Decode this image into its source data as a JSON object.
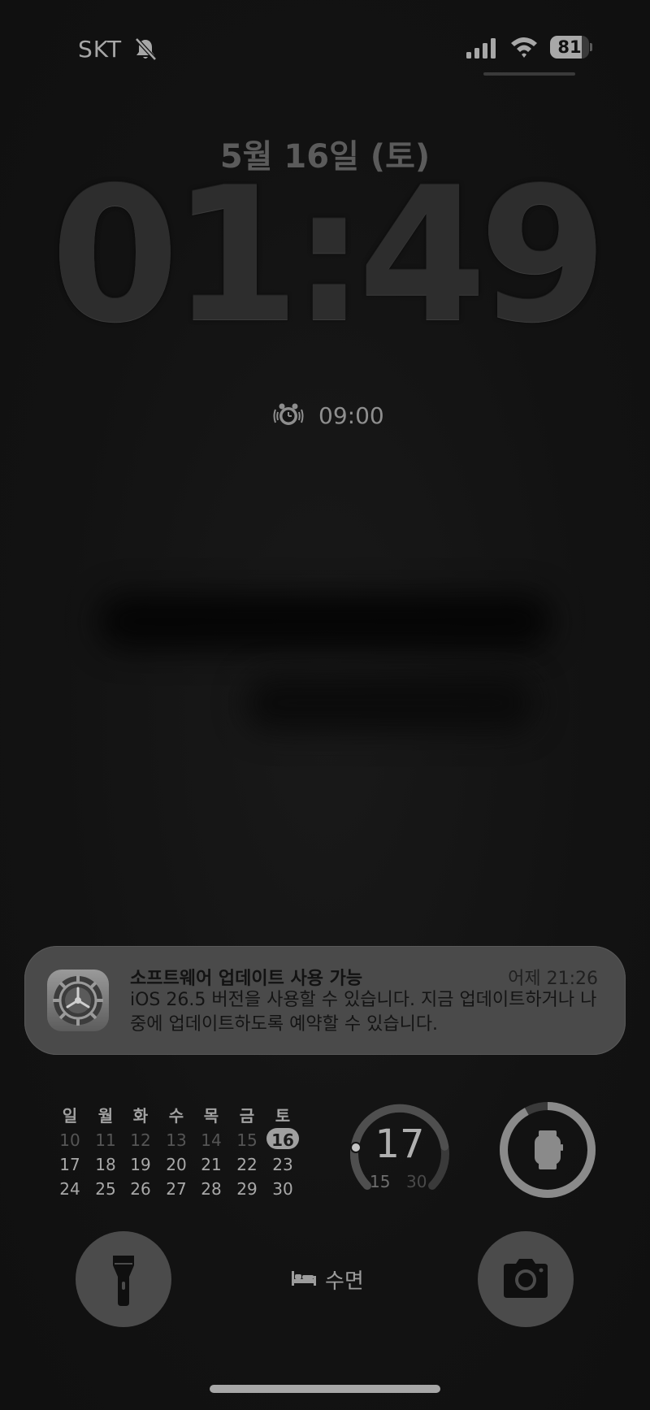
{
  "status_bar": {
    "carrier": "SKT",
    "silent_icon": "bell-slash-icon",
    "signal_icon": "cellular-signal-icon",
    "wifi_icon": "wifi-icon",
    "battery_level": "81",
    "battery_fraction": 0.81
  },
  "lock_screen": {
    "date": "5월 16일 (토)",
    "time": "01:49"
  },
  "alarm": {
    "icon": "alarm-clock-icon",
    "time": "09:00"
  },
  "notification": {
    "app_icon": "settings-gear-icon",
    "title": "소프트웨어 업데이트 사용 가능",
    "time": "어제 21:26",
    "body": "iOS 26.5 버전을 사용할 수 있습니다. 지금 업데이트하거나 나중에 업데이트하도록 예약할 수 있습니다."
  },
  "calendar_widget": {
    "weekdays": [
      "일",
      "월",
      "화",
      "수",
      "목",
      "금",
      "토"
    ],
    "weeks": [
      [
        "10",
        "11",
        "12",
        "13",
        "14",
        "15",
        "16"
      ],
      [
        "17",
        "18",
        "19",
        "20",
        "21",
        "22",
        "23"
      ],
      [
        "24",
        "25",
        "26",
        "27",
        "28",
        "29",
        "30"
      ]
    ],
    "today": "16"
  },
  "weather_widget": {
    "current_temp": "17",
    "low": "15",
    "high": "30"
  },
  "watch_battery_widget": {
    "icon": "apple-watch-icon",
    "level_fraction": 0.92
  },
  "controls": {
    "flashlight_icon": "flashlight-icon",
    "camera_icon": "camera-icon",
    "sleep_icon": "bed-icon",
    "sleep_label": "수면"
  },
  "colors": {
    "background": "#141414",
    "clock": "#2d2d2d",
    "notification_bg": "#4a4a4a",
    "control_button": "#4b4b4b"
  }
}
